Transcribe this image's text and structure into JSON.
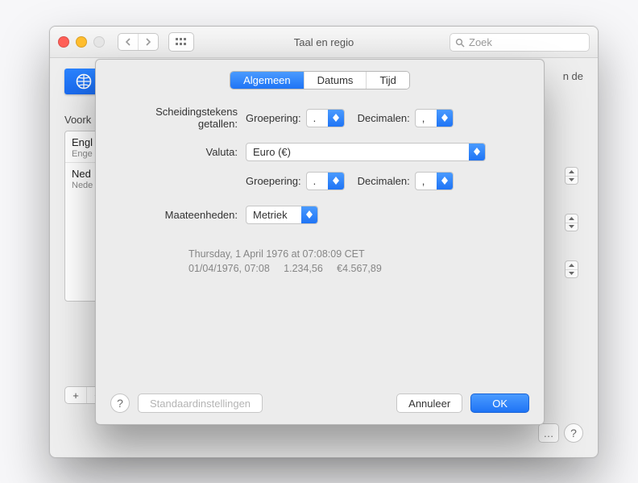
{
  "window": {
    "title": "Taal en regio",
    "search_placeholder": "Zoek",
    "header_text": "n de",
    "pref_label": "Voork",
    "languages": [
      {
        "primary": "Engl",
        "secondary": "Enge"
      },
      {
        "primary": "Ned",
        "secondary": "Nede"
      }
    ],
    "add_label": "+",
    "remove_label": "−"
  },
  "sheet": {
    "tabs": {
      "general": "Algemeen",
      "dates": "Datums",
      "time": "Tijd"
    },
    "labels": {
      "number_separators": "Scheidingstekens getallen:",
      "grouping": "Groepering:",
      "decimals": "Decimalen:",
      "currency": "Valuta:",
      "units": "Maateenheden:"
    },
    "values": {
      "num_grouping": ".",
      "num_decimals": ",",
      "currency": "Euro (€)",
      "cur_grouping": ".",
      "cur_decimals": ",",
      "units": "Metriek"
    },
    "preview": {
      "line1": "Thursday, 1 April 1976 at 07:08:09 CET",
      "line2": "01/04/1976, 07:08     1.234,56     €4.567,89"
    },
    "footer": {
      "defaults": "Standaardinstellingen",
      "cancel": "Annuleer",
      "ok": "OK"
    }
  },
  "misc": {
    "dots": "…",
    "help": "?"
  }
}
